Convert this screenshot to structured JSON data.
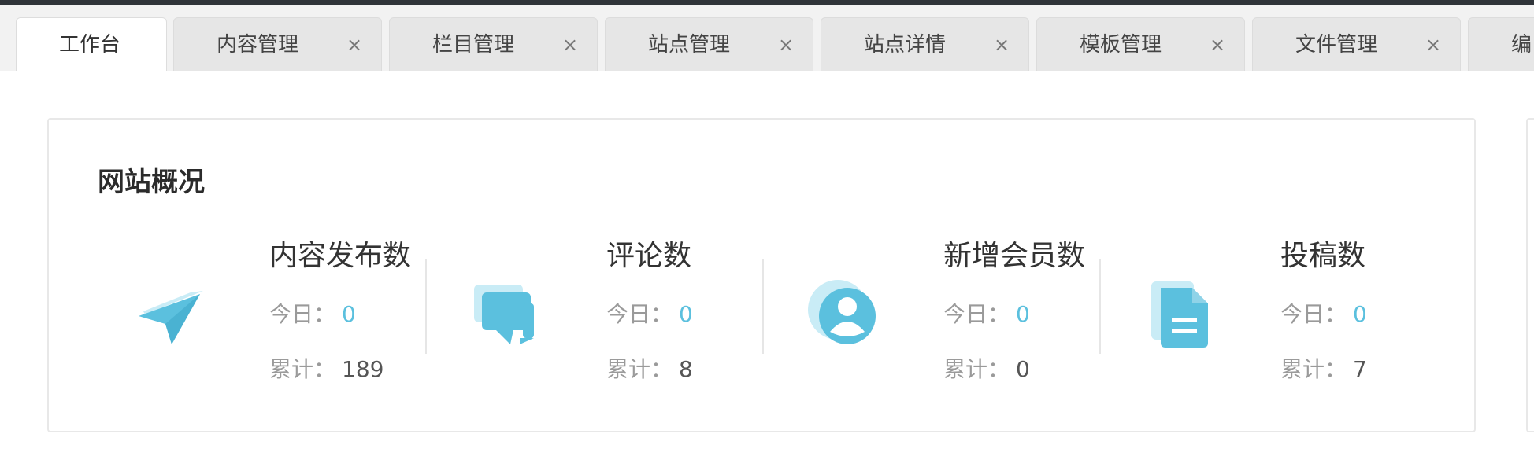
{
  "colors": {
    "accent": "#5bc0de",
    "accent_light": "#c9ecf6",
    "topbar": "#2f3439"
  },
  "tabs": [
    {
      "label": "工作台",
      "closable": false,
      "active": true
    },
    {
      "label": "内容管理",
      "closable": true,
      "active": false
    },
    {
      "label": "栏目管理",
      "closable": true,
      "active": false
    },
    {
      "label": "站点管理",
      "closable": true,
      "active": false
    },
    {
      "label": "站点详情",
      "closable": true,
      "active": false
    },
    {
      "label": "模板管理",
      "closable": true,
      "active": false
    },
    {
      "label": "文件管理",
      "closable": true,
      "active": false
    },
    {
      "label": "编",
      "closable": false,
      "active": false
    }
  ],
  "close_glyph": "×",
  "overview": {
    "title": "网站概况",
    "stats": [
      {
        "icon": "paper-plane-icon",
        "title": "内容发布数",
        "today_label": "今日：",
        "today_value": "0",
        "total_label": "累计：",
        "total_value": "189"
      },
      {
        "icon": "comments-icon",
        "title": "评论数",
        "today_label": "今日：",
        "today_value": "0",
        "total_label": "累计：",
        "total_value": "8"
      },
      {
        "icon": "user-circle-icon",
        "title": "新增会员数",
        "today_label": "今日：",
        "today_value": "0",
        "total_label": "累计：",
        "total_value": "0"
      },
      {
        "icon": "document-icon",
        "title": "投稿数",
        "today_label": "今日：",
        "today_value": "0",
        "total_label": "累计：",
        "total_value": "7"
      }
    ]
  }
}
